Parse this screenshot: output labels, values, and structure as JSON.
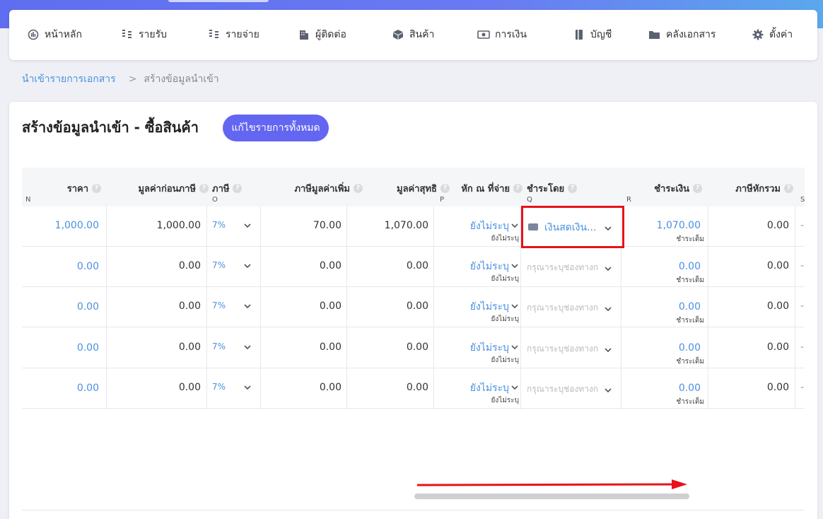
{
  "nav": {
    "items": [
      {
        "label": "หน้าหลัก",
        "icon": "dashboard-icon"
      },
      {
        "label": "รายรับ",
        "icon": "coins-icon"
      },
      {
        "label": "รายจ่าย",
        "icon": "coins-icon"
      },
      {
        "label": "ผู้ติดต่อ",
        "icon": "building-icon"
      },
      {
        "label": "สินค้า",
        "icon": "box-icon"
      },
      {
        "label": "การเงิน",
        "icon": "money-icon"
      },
      {
        "label": "บัญชี",
        "icon": "book-icon"
      },
      {
        "label": "คลังเอกสาร",
        "icon": "folder-icon"
      },
      {
        "label": "ตั้งค่า",
        "icon": "gear-icon"
      }
    ]
  },
  "breadcrumb": {
    "link": "นำเข้ารายการเอกสาร",
    "separator": ">",
    "current": "สร้างข้อมูลนำเข้า"
  },
  "page": {
    "title": "สร้างข้อมูลนำเข้า - ซื้อสินค้า",
    "edit_all_label": "แก้ไขรายการทั้งหมด"
  },
  "table": {
    "headers": {
      "price": "ราคา",
      "pre_tax": "มูลค่าก่อนภาษี",
      "tax": "ภาษี",
      "vat": "ภาษีมูลค่าเพิ่ม",
      "net": "มูลค่าสุทธิ",
      "withholding": "หัก ณ ที่จ่าย",
      "pay_by": "ชำระโดย",
      "paid": "ชำระเงิน",
      "total_wht": "ภาษีหักรวม"
    },
    "col_letters": {
      "n": "N",
      "o": "O",
      "p": "P",
      "q": "Q",
      "r": "R",
      "s": "S"
    },
    "help_glyph": "?",
    "rows": [
      {
        "price": "1,000.00",
        "pre_tax": "1,000.00",
        "tax": "7%",
        "vat": "70.00",
        "net": "1,070.00",
        "wht": "ยังไม่ระบุ",
        "wht_sub": "ยังไม่ระบุ",
        "pay_by": "เงินสดเงิน...",
        "pay_selected": true,
        "paid": "1,070.00",
        "paid_sub": "ชำระเต็ม",
        "total_wht": "0.00",
        "extra": "-"
      },
      {
        "price": "0.00",
        "pre_tax": "0.00",
        "tax": "7%",
        "vat": "0.00",
        "net": "0.00",
        "wht": "ยังไม่ระบุ",
        "wht_sub": "ยังไม่ระบุ",
        "pay_by": "กรุณาระบุช่องทางก",
        "pay_selected": false,
        "paid": "0.00",
        "paid_sub": "ชำระเต็ม",
        "total_wht": "0.00",
        "extra": "-"
      },
      {
        "price": "0.00",
        "pre_tax": "0.00",
        "tax": "7%",
        "vat": "0.00",
        "net": "0.00",
        "wht": "ยังไม่ระบุ",
        "wht_sub": "ยังไม่ระบุ",
        "pay_by": "กรุณาระบุช่องทางก",
        "pay_selected": false,
        "paid": "0.00",
        "paid_sub": "ชำระเต็ม",
        "total_wht": "0.00",
        "extra": "-"
      },
      {
        "price": "0.00",
        "pre_tax": "0.00",
        "tax": "7%",
        "vat": "0.00",
        "net": "0.00",
        "wht": "ยังไม่ระบุ",
        "wht_sub": "ยังไม่ระบุ",
        "pay_by": "กรุณาระบุช่องทางก",
        "pay_selected": false,
        "paid": "0.00",
        "paid_sub": "ชำระเต็ม",
        "total_wht": "0.00",
        "extra": "-"
      },
      {
        "price": "0.00",
        "pre_tax": "0.00",
        "tax": "7%",
        "vat": "0.00",
        "net": "0.00",
        "wht": "ยังไม่ระบุ",
        "wht_sub": "ยังไม่ระบุ",
        "pay_by": "กรุณาระบุช่องทางก",
        "pay_selected": false,
        "paid": "0.00",
        "paid_sub": "ชำระเต็ม",
        "total_wht": "0.00",
        "extra": "-"
      }
    ]
  },
  "colors": {
    "accent": "#6366f1",
    "link": "#4a90e2",
    "highlight": "#e8121a"
  }
}
